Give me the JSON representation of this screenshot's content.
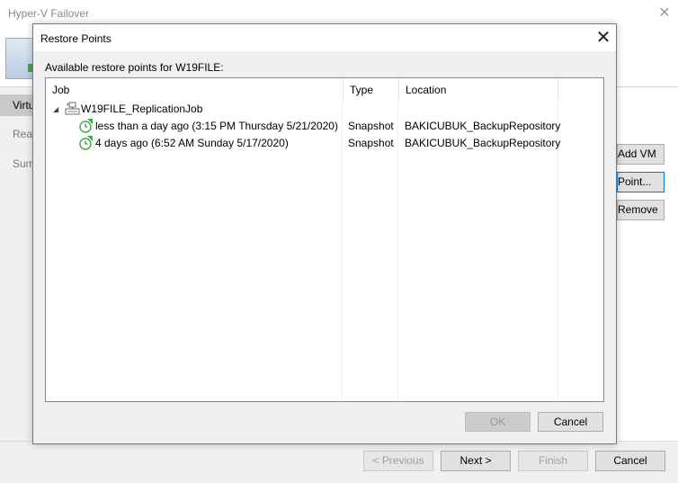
{
  "background_window": {
    "title": "Hyper-V Failover",
    "nav_items": [
      "Virtu",
      "Reas",
      "Sum"
    ],
    "side_buttons": [
      "Add VM",
      "Point...",
      "Remove"
    ],
    "footer_buttons": {
      "previous": "< Previous",
      "next": "Next >",
      "finish": "Finish",
      "cancel": "Cancel"
    }
  },
  "dialog": {
    "title": "Restore Points",
    "caption": "Available restore points for W19FILE:",
    "columns": {
      "job": "Job",
      "type": "Type",
      "location": "Location"
    },
    "job": {
      "name": "W19FILE_ReplicationJob",
      "expanded": true
    },
    "restore_points": [
      {
        "label": "less than a day ago (3:15 PM Thursday 5/21/2020)",
        "type": "Snapshot",
        "location": "BAKICUBUK_BackupRepository"
      },
      {
        "label": "4 days ago (6:52 AM Sunday 5/17/2020)",
        "type": "Snapshot",
        "location": "BAKICUBUK_BackupRepository"
      }
    ],
    "buttons": {
      "ok": "OK",
      "cancel": "Cancel"
    }
  },
  "icons": {
    "close": "close-icon",
    "expander": "collapse-triangle-icon",
    "job": "replication-job-icon",
    "restore_point": "restore-point-clock-icon"
  },
  "colors": {
    "accent_focus": "#0078d7",
    "icon_green": "#3daa49",
    "dialog_bg": "#f0f0f0"
  }
}
